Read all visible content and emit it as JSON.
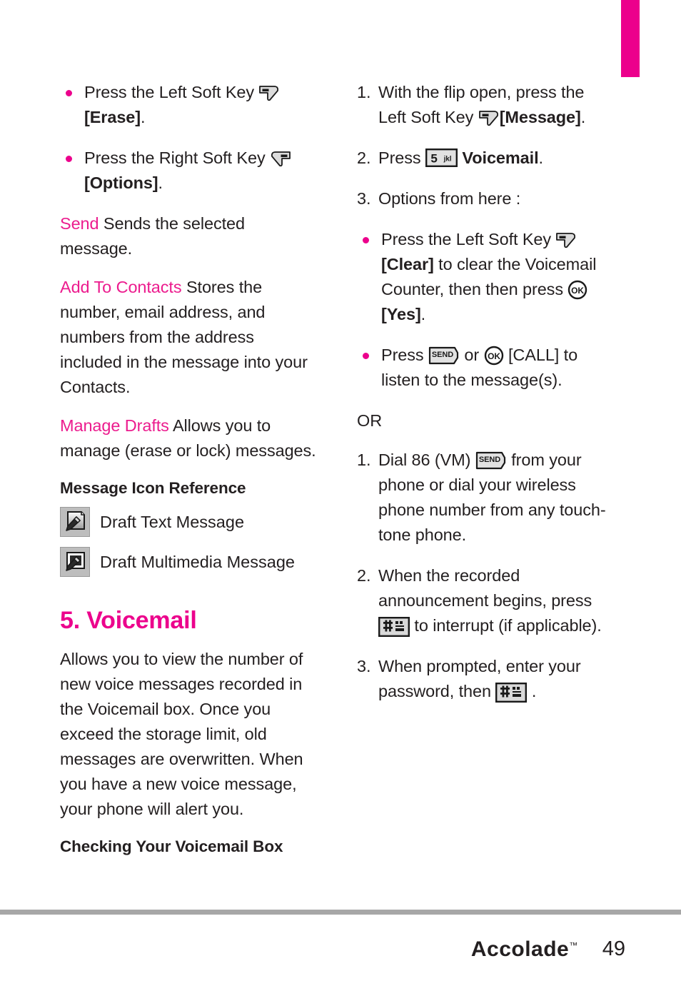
{
  "page": {
    "number": "49",
    "brand": "Accolade",
    "brand_tm": "™",
    "accent_pink": "#ec008c",
    "term_pink": "#ec1c8e",
    "footer_rule_color": "#a7a7a7"
  },
  "left_column": {
    "bullets": [
      {
        "text_before": "Press the Left Soft Key ",
        "icon": "left-soft-key-icon",
        "text_after_bold": "[Erase]",
        "text_end": "."
      },
      {
        "text_before": "Press the Right Soft Key ",
        "icon": "right-soft-key-icon",
        "text_after_bold": "[Options]",
        "text_end": "."
      }
    ],
    "definitions": [
      {
        "term": "Send",
        "description": "  Sends the selected message."
      },
      {
        "term": "Add To Contacts",
        "description": "  Stores the number, email address, and numbers from the address included in the message into your Contacts."
      },
      {
        "term": "Manage Drafts",
        "description": "  Allows you to manage (erase or lock) messages."
      }
    ],
    "icon_reference": {
      "heading": "Message Icon Reference",
      "items": [
        {
          "icon": "draft-text-message-icon",
          "label": "Draft Text Message"
        },
        {
          "icon": "draft-multimedia-message-icon",
          "label": "Draft Multimedia Message"
        }
      ]
    },
    "section": {
      "heading": "5. Voicemail",
      "body": "Allows you to view the number of new voice messages recorded in the Voicemail box. Once you exceed the storage limit, old messages are overwritten. When you have a new voice message, your phone will alert you.",
      "subheading": "Checking Your Voicemail Box"
    }
  },
  "right_column": {
    "steps_primary": [
      {
        "marker": "1.",
        "part1": "With the flip open, press the Left Soft Key ",
        "icon": "left-soft-key-icon",
        "part2_bold": "[Message]",
        "part3": "."
      },
      {
        "marker": "2.",
        "part1": "Press  ",
        "icon": "key-5-jkl-icon",
        "part2_bold": "  Voicemail",
        "part3": "."
      },
      {
        "marker": "3.",
        "part1": "Options from here :",
        "icon": "",
        "part2_bold": "",
        "part3": ""
      }
    ],
    "bullets": [
      {
        "part1": "Press the Left Soft Key ",
        "icon1": "left-soft-key-icon",
        "part2_bold": "[Clear]",
        "part3": " to clear the Voicemail Counter, then then press  ",
        "icon2": "ok-key-icon",
        "part4_bold": "[Yes]",
        "part5": "."
      },
      {
        "part1": "Press  ",
        "icon1": "send-key-icon",
        "part2": "  or  ",
        "icon2": "ok-key-icon",
        "part3": "  [CALL] to listen to the message(s)."
      }
    ],
    "or_label": "OR",
    "steps_secondary": [
      {
        "marker": "1.",
        "part1": "Dial 86 (VM)  ",
        "icon": "send-key-icon",
        "part2": "  from your phone or dial your wireless phone number from any touch-tone phone."
      },
      {
        "marker": "2.",
        "part1": "When the recorded announcement begins, press  ",
        "icon": "hash-space-key-icon",
        "part2": "  to interrupt (if applicable)."
      },
      {
        "marker": "3.",
        "part1": "When prompted, enter your password, then  ",
        "icon": "hash-space-key-icon",
        "part2": " ."
      }
    ]
  },
  "icon_labels": {
    "key_5_digit": "5",
    "key_5_letters": "jkl",
    "send_text": "SEND",
    "ok_text": "OK",
    "hash_space_text": "space"
  }
}
